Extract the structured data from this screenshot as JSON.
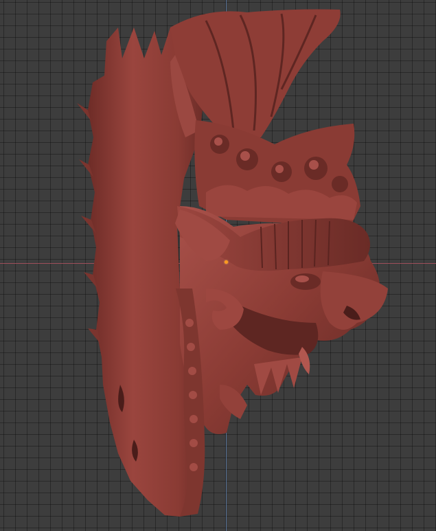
{
  "viewport": {
    "background": "#3d3d3d",
    "grid_color": "#2b2b2b",
    "x_axis_color": "#a8505e",
    "y_axis_color": "#5a79a3"
  },
  "model": {
    "material_color": "#8a3b34",
    "highlight_color": "#a8504a",
    "shadow_color": "#5a2420",
    "subject": "carved-mask-sculpt"
  },
  "origin": {
    "color": "#ff9a1f"
  }
}
